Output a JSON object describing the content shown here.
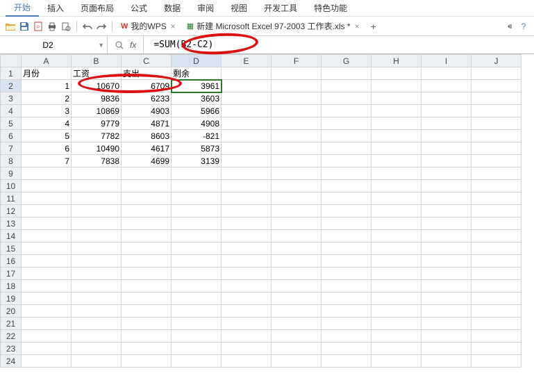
{
  "menu": {
    "items": [
      "开始",
      "插入",
      "页面布局",
      "公式",
      "数据",
      "审阅",
      "视图",
      "开发工具",
      "特色功能"
    ],
    "active_index": 0
  },
  "toolbar": {
    "tab_wps": "我的WPS",
    "tab_file": "新建 Microsoft Excel 97-2003 工作表.xls *"
  },
  "formula_bar": {
    "cell_ref": "D2",
    "fx_label": "fx",
    "formula": "=SUM(B2-C2)"
  },
  "columns": [
    "A",
    "B",
    "C",
    "D",
    "E",
    "F",
    "G",
    "H",
    "I",
    "J"
  ],
  "row_count": 24,
  "headers": {
    "A": "月份",
    "B": "工资",
    "C": "支出",
    "D": "剩余"
  },
  "data_rows": [
    {
      "A": 1,
      "B": 10670,
      "C": 6709,
      "D": 3961
    },
    {
      "A": 2,
      "B": 9836,
      "C": 6233,
      "D": 3603
    },
    {
      "A": 3,
      "B": 10869,
      "C": 4903,
      "D": 5966
    },
    {
      "A": 4,
      "B": 9779,
      "C": 4871,
      "D": 4908
    },
    {
      "A": 5,
      "B": 7782,
      "C": 8603,
      "D": -821
    },
    {
      "A": 6,
      "B": 10490,
      "C": 4617,
      "D": 5873
    },
    {
      "A": 7,
      "B": 7838,
      "C": 4699,
      "D": 3139
    }
  ],
  "active_cell": {
    "row": 2,
    "col": "D"
  }
}
